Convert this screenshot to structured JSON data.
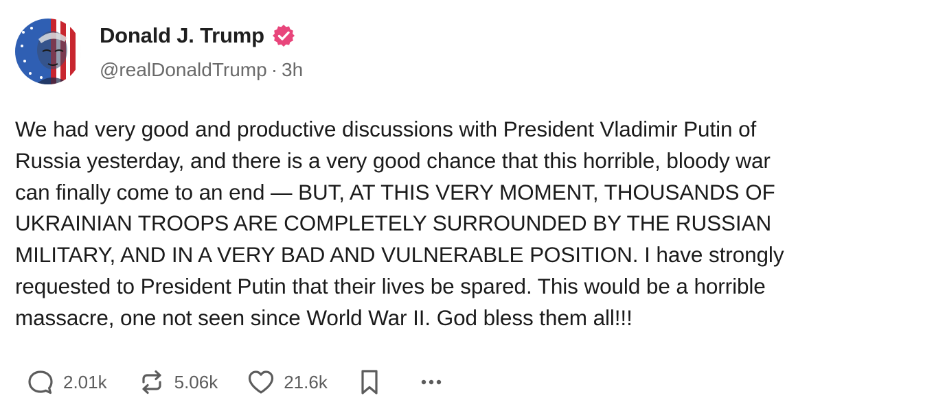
{
  "post": {
    "author": {
      "display_name": "Donald J. Trump",
      "handle": "@realDonaldTrump",
      "separator": "·",
      "time_ago": "3h",
      "verified_color": "#e8457b",
      "avatar_icon": "avatar-flag-portrait"
    },
    "body": "We had very good and productive discussions with President Vladimir Putin of\nRussia yesterday, and there is a very good chance that this horrible, bloody war\ncan finally come to an end — BUT, AT THIS VERY MOMENT, THOUSANDS OF\nUKRAINIAN TROOPS ARE COMPLETELY SURROUNDED BY THE RUSSIAN\nMILITARY, AND IN A VERY BAD AND VULNERABLE POSITION. I have strongly\nrequested to President Putin that their lives be spared. This would be a horrible\nmassacre, one not seen since World War II. God bless them all!!!",
    "actions": {
      "replies": "2.01k",
      "reposts": "5.06k",
      "likes": "21.6k",
      "reply_icon": "reply-icon",
      "repost_icon": "repost-icon",
      "like_icon": "heart-icon",
      "bookmark_icon": "bookmark-icon",
      "more_icon": "more-icon"
    },
    "colors": {
      "text": "#1b1b1b",
      "muted": "#6a6a6a",
      "icon": "#5c5c5c"
    }
  }
}
